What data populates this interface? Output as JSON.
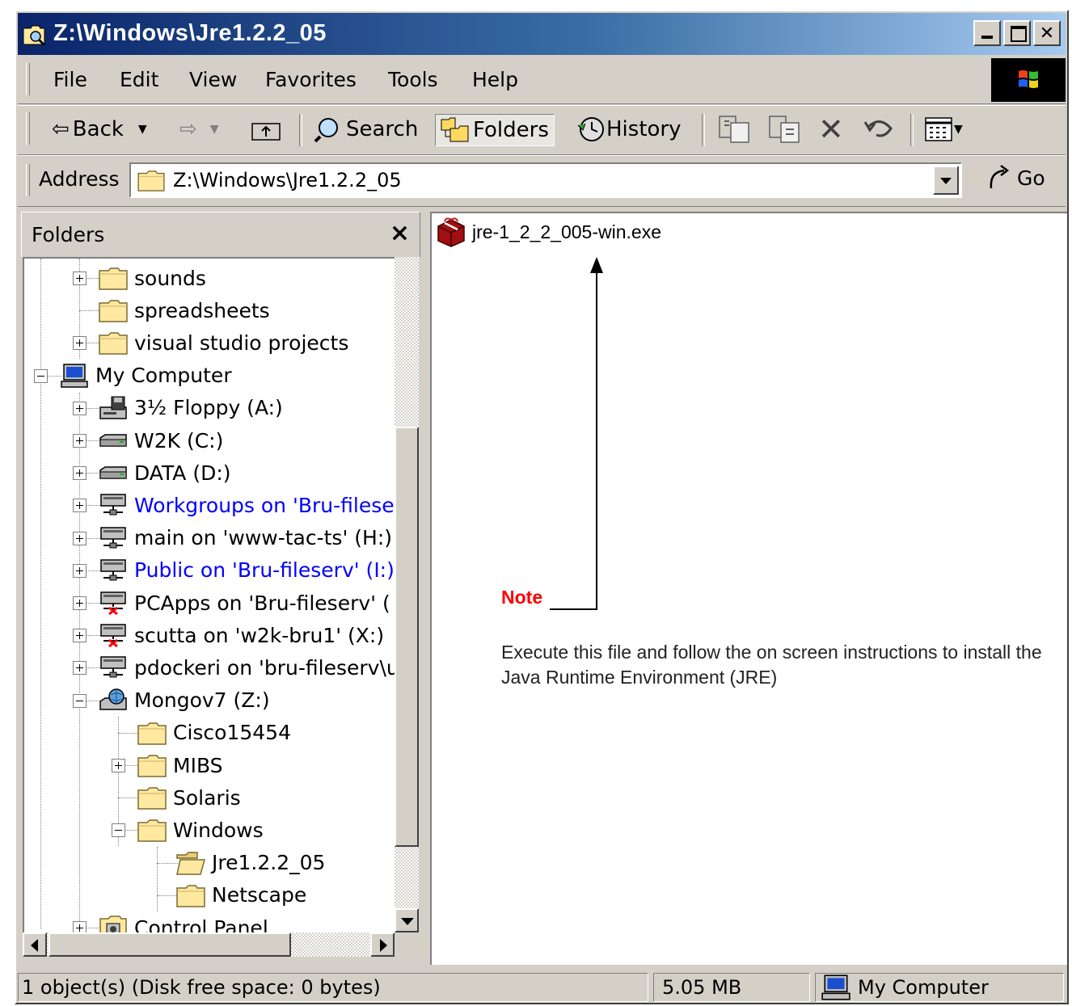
{
  "window": {
    "title": "Z:\\Windows\\Jre1.2.2_05"
  },
  "menu": [
    "File",
    "Edit",
    "View",
    "Favorites",
    "Tools",
    "Help"
  ],
  "toolbar": {
    "back": "Back",
    "search": "Search",
    "folders": "Folders",
    "history": "History"
  },
  "address": {
    "label": "Address",
    "value": "Z:\\Windows\\Jre1.2.2_05",
    "go": "Go"
  },
  "folders_pane": {
    "title": "Folders",
    "close": "×"
  },
  "tree": [
    {
      "label": "sounds",
      "icon": "folder-icon",
      "expander": "plus"
    },
    {
      "label": "spreadsheets",
      "icon": "folder-icon",
      "expander": "none"
    },
    {
      "label": "visual studio projects",
      "icon": "folder-icon",
      "expander": "plus"
    },
    {
      "label": "My Computer",
      "icon": "my-computer-icon",
      "expander": "minus"
    },
    {
      "label": "3½ Floppy (A:)",
      "icon": "floppy-drive-icon",
      "expander": "plus"
    },
    {
      "label": "W2K (C:)",
      "icon": "hard-drive-icon",
      "expander": "plus"
    },
    {
      "label": "DATA (D:)",
      "icon": "hard-drive-icon",
      "expander": "plus"
    },
    {
      "label": "Workgroups on 'Bru-filese",
      "icon": "network-drive-icon",
      "expander": "plus",
      "link": true
    },
    {
      "label": "main on 'www-tac-ts' (H:)",
      "icon": "network-drive-icon",
      "expander": "plus"
    },
    {
      "label": "Public on 'Bru-fileserv' (I:)",
      "icon": "network-drive-icon",
      "expander": "plus",
      "link": true
    },
    {
      "label": "PCApps on 'Bru-fileserv' (",
      "icon": "disconnected-drive-icon",
      "expander": "plus"
    },
    {
      "label": "scutta on 'w2k-bru1' (X:)",
      "icon": "disconnected-drive-icon",
      "expander": "plus"
    },
    {
      "label": "pdockeri on 'bru-fileserv\\u",
      "icon": "network-drive-icon",
      "expander": "plus"
    },
    {
      "label": "Mongov7 (Z:)",
      "icon": "mapped-drive-icon",
      "expander": "minus"
    },
    {
      "label": "Cisco15454",
      "icon": "folder-icon",
      "expander": "none"
    },
    {
      "label": "MIBS",
      "icon": "folder-icon",
      "expander": "plus"
    },
    {
      "label": "Solaris",
      "icon": "folder-icon",
      "expander": "none"
    },
    {
      "label": "Windows",
      "icon": "folder-icon",
      "expander": "minus"
    },
    {
      "label": "Jre1.2.2_05",
      "icon": "open-folder-icon",
      "expander": "none"
    },
    {
      "label": "Netscape",
      "icon": "folder-icon",
      "expander": "none"
    },
    {
      "label": "Control Panel",
      "icon": "control-panel-icon",
      "expander": "plus"
    }
  ],
  "content": {
    "file_name": "jre-1_2_2_005-win.exe",
    "note_label": "Note",
    "note_text": "Execute this file and follow the on screen instructions to install the Java Runtime Environment (JRE)"
  },
  "status": {
    "objects": "1 object(s) (Disk free space: 0 bytes)",
    "size": "5.05 MB",
    "zone": "My Computer"
  },
  "colors": {
    "title_start": "#0a246a",
    "title_end": "#a6caf0",
    "face": "#d4d0c8",
    "link_blue": "#0000ff",
    "note_red": "#ff0000"
  }
}
